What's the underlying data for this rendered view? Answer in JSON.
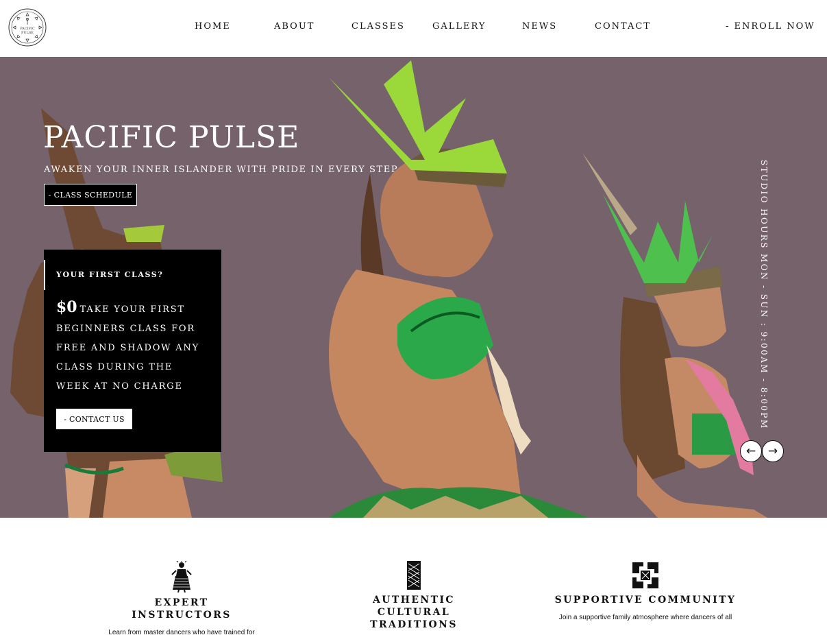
{
  "brand": {
    "logo_text_line1": "PACIFIC",
    "logo_text_line2": "PULSE"
  },
  "nav": {
    "items": [
      "HOME",
      "ABOUT",
      "CLASSES",
      "GALLERY",
      "NEWS",
      "CONTACT"
    ],
    "enroll_label": "- ENROLL NOW"
  },
  "hero": {
    "title": "PACIFIC PULSE",
    "tagline": "AWAKEN YOUR INNER ISLANDER WITH PRIDE IN EVERY STEP",
    "schedule_button": "- CLASS SCHEDULE",
    "background_color": "#75626b",
    "studio_hours": "STUDIO HOURS MON - SUN : 9:00AM - 8:00PM",
    "prev_arrow": "←",
    "next_arrow": "→"
  },
  "promo": {
    "label": "YOUR FIRST CLASS?",
    "price": "$0",
    "text": "TAKE YOUR FIRST BEGINNERS CLASS FOR FREE AND SHADOW ANY CLASS DURING THE WEEK AT NO CHARGE",
    "contact_button": "- CONTACT US"
  },
  "features": [
    {
      "icon": "dancer-icon",
      "title": "EXPERT INSTRUCTORS",
      "text": "Learn from master dancers who have trained for"
    },
    {
      "icon": "tapa-pattern-icon",
      "title": "AUTHENTIC CULTURAL TRADITIONS",
      "text": ""
    },
    {
      "icon": "joined-hands-icon",
      "title": "SUPPORTIVE COMMUNITY",
      "text": "Join a supportive family atmosphere where dancers of all"
    }
  ]
}
